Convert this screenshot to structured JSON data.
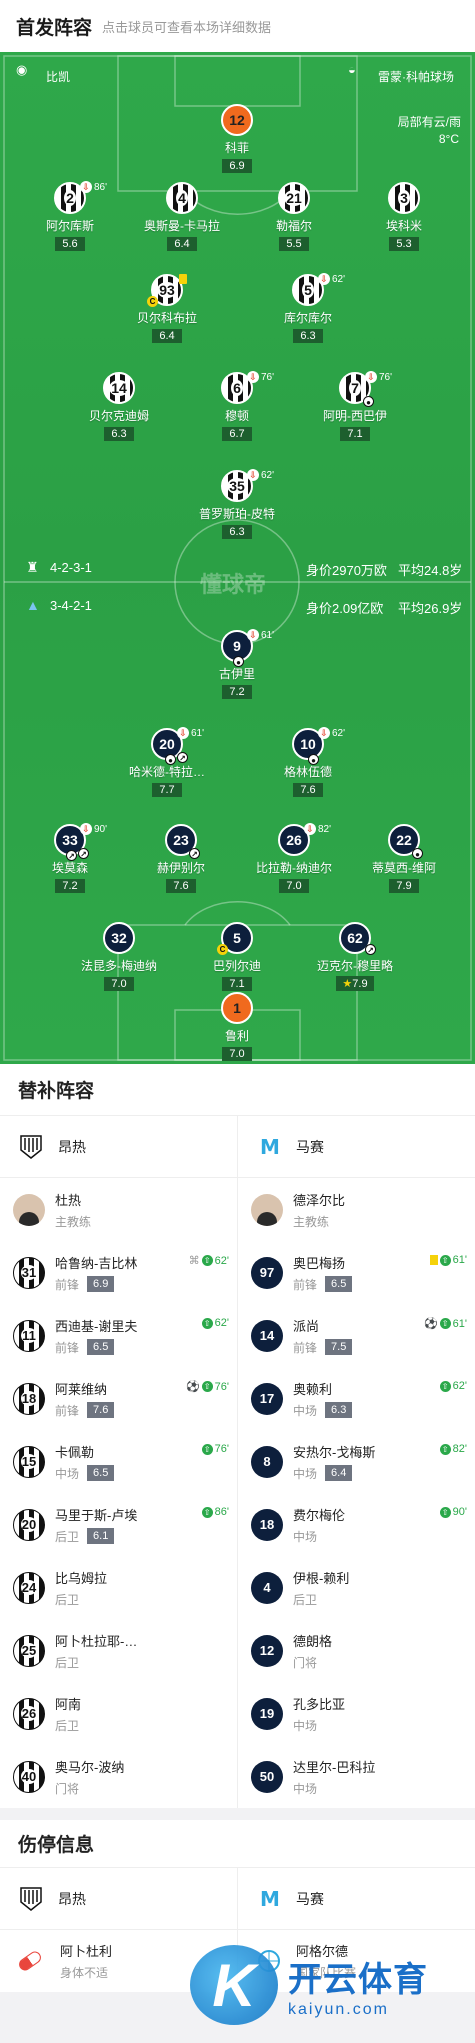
{
  "header": {
    "title": "首发阵容",
    "subtitle": "点击球员可查看本场详细数据"
  },
  "pitch_info": {
    "referee": "比凯",
    "venue": "雷蒙·科帕球场",
    "weather": "局部有云/雨",
    "temperature": "8°C",
    "watermark": "懂球帝",
    "home_formation": "4-2-3-1",
    "home_value": "身价2970万欧",
    "home_age": "平均24.8岁",
    "away_formation": "3-4-2-1",
    "away_value": "身价2.09亿欧",
    "away_age": "平均26.9岁"
  },
  "home_players": [
    {
      "num": "12",
      "name": "科菲",
      "rating": "6.9"
    },
    {
      "num": "2",
      "name": "阿尔库斯",
      "rating": "5.6",
      "sub": "86'"
    },
    {
      "num": "4",
      "name": "奥斯曼-卡马拉",
      "rating": "6.4"
    },
    {
      "num": "21",
      "name": "勒福尔",
      "rating": "5.5"
    },
    {
      "num": "3",
      "name": "埃科米",
      "rating": "5.3"
    },
    {
      "num": "93",
      "name": "贝尔科布拉",
      "rating": "6.4"
    },
    {
      "num": "5",
      "name": "库尔库尔",
      "rating": "6.3",
      "sub": "62'"
    },
    {
      "num": "14",
      "name": "贝尔克迪姆",
      "rating": "6.3"
    },
    {
      "num": "6",
      "name": "穆顿",
      "rating": "6.7",
      "sub": "76'"
    },
    {
      "num": "7",
      "name": "阿明-西巴伊",
      "rating": "7.1",
      "sub": "76'"
    },
    {
      "num": "35",
      "name": "普罗斯珀-皮特",
      "rating": "6.3",
      "sub": "62'"
    }
  ],
  "away_players": [
    {
      "num": "9",
      "name": "古伊里",
      "rating": "7.2",
      "sub": "61'"
    },
    {
      "num": "20",
      "name": "哈米德-特拉…",
      "rating": "7.7",
      "sub": "61'"
    },
    {
      "num": "10",
      "name": "格林伍德",
      "rating": "7.6",
      "sub": "62'"
    },
    {
      "num": "33",
      "name": "埃莫森",
      "rating": "7.2",
      "sub": "90'"
    },
    {
      "num": "23",
      "name": "赫伊别尔",
      "rating": "7.6"
    },
    {
      "num": "26",
      "name": "比拉勒-纳迪尔",
      "rating": "7.0",
      "sub": "82'"
    },
    {
      "num": "22",
      "name": "蒂莫西-维阿",
      "rating": "7.9"
    },
    {
      "num": "32",
      "name": "法昆多-梅迪纳",
      "rating": "7.0"
    },
    {
      "num": "5",
      "name": "巴列尔迪",
      "rating": "7.1"
    },
    {
      "num": "62",
      "name": "迈克尔-穆里略",
      "rating": "7.9"
    },
    {
      "num": "1",
      "name": "鲁利",
      "rating": "7.0"
    }
  ],
  "subs": {
    "title": "替补阵容",
    "home_team": "昂热",
    "away_team": "马赛",
    "home_coach": {
      "name": "杜热",
      "role": "主教练"
    },
    "away_coach": {
      "name": "德泽尔比",
      "role": "主教练"
    },
    "home": [
      {
        "num": "31",
        "name": "哈鲁纳-吉比林",
        "pos": "前锋",
        "rating": "6.9",
        "minute": "62'"
      },
      {
        "num": "11",
        "name": "西迪基-谢里夫",
        "pos": "前锋",
        "rating": "6.5",
        "minute": "62'"
      },
      {
        "num": "18",
        "name": "阿莱维纳",
        "pos": "前锋",
        "rating": "7.6",
        "minute": "76'"
      },
      {
        "num": "15",
        "name": "卡佩勒",
        "pos": "中场",
        "rating": "6.5",
        "minute": "76'"
      },
      {
        "num": "20",
        "name": "马里于斯-卢埃",
        "pos": "后卫",
        "rating": "6.1",
        "minute": "86'"
      },
      {
        "num": "24",
        "name": "比乌姆拉",
        "pos": "后卫"
      },
      {
        "num": "25",
        "name": "阿卜杜拉耶-…",
        "pos": "后卫"
      },
      {
        "num": "26",
        "name": "阿南",
        "pos": "后卫"
      },
      {
        "num": "40",
        "name": "奥马尔-波纳",
        "pos": "门将"
      }
    ],
    "away": [
      {
        "num": "97",
        "name": "奥巴梅扬",
        "pos": "前锋",
        "rating": "6.5",
        "minute": "61'"
      },
      {
        "num": "14",
        "name": "派尚",
        "pos": "前锋",
        "rating": "7.5",
        "minute": "61'"
      },
      {
        "num": "17",
        "name": "奥赖利",
        "pos": "中场",
        "rating": "6.3",
        "minute": "62'"
      },
      {
        "num": "8",
        "name": "安热尔-戈梅斯",
        "pos": "中场",
        "rating": "6.4",
        "minute": "82'"
      },
      {
        "num": "18",
        "name": "费尔梅伦",
        "pos": "中场",
        "minute": "90'"
      },
      {
        "num": "4",
        "name": "伊根-赖利",
        "pos": "后卫"
      },
      {
        "num": "12",
        "name": "德朗格",
        "pos": "门将"
      },
      {
        "num": "19",
        "name": "孔多比亚",
        "pos": "中场"
      },
      {
        "num": "50",
        "name": "达里尔-巴科拉",
        "pos": "中场"
      }
    ]
  },
  "injuries": {
    "title": "伤停信息",
    "home_team": "昂热",
    "away_team": "马赛",
    "home": [
      {
        "name": "阿卜杜利",
        "reason": "身体不适"
      }
    ],
    "away": [
      {
        "name": "阿格尔德",
        "reason": "国家队比赛"
      }
    ]
  },
  "watermark": {
    "logo": "K",
    "cn": "开云体育",
    "en": "kaiyun.com"
  }
}
